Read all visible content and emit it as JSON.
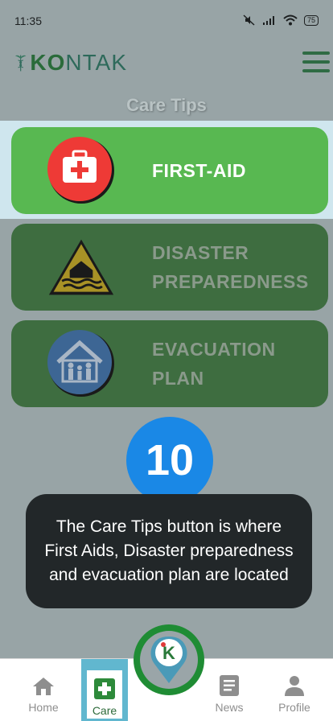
{
  "status_bar": {
    "time": "11:35",
    "icons": [
      "mute-icon",
      "signal-icon",
      "wifi-icon"
    ],
    "battery": "75"
  },
  "header": {
    "logo_text_k": "K",
    "logo_text_rest": "NTAK",
    "logo_o": "O"
  },
  "page": {
    "title": "Care Tips"
  },
  "cards": [
    {
      "label": "FIRST-AID",
      "icon": "first-aid-kit-icon"
    },
    {
      "label_line1": "DISASTER",
      "label_line2": "PREPAREDNESS",
      "icon": "flood-warning-icon"
    },
    {
      "label_line1": "EVACUATION",
      "label_line2": "PLAN",
      "icon": "family-shelter-icon"
    }
  ],
  "tutorial": {
    "step": "10",
    "message": "The Care Tips button is where First Aids, Disaster preparedness and evacuation plan are located"
  },
  "nav": {
    "home": "Home",
    "care": "Care",
    "news": "News",
    "profile": "Profile",
    "center_logo": "K"
  },
  "colors": {
    "accent_green": "#58b851",
    "dim_green": "#3e6d40",
    "badge_blue": "#1a88e6",
    "tooltip_bg": "#222729",
    "highlight": "#61b7cf"
  }
}
